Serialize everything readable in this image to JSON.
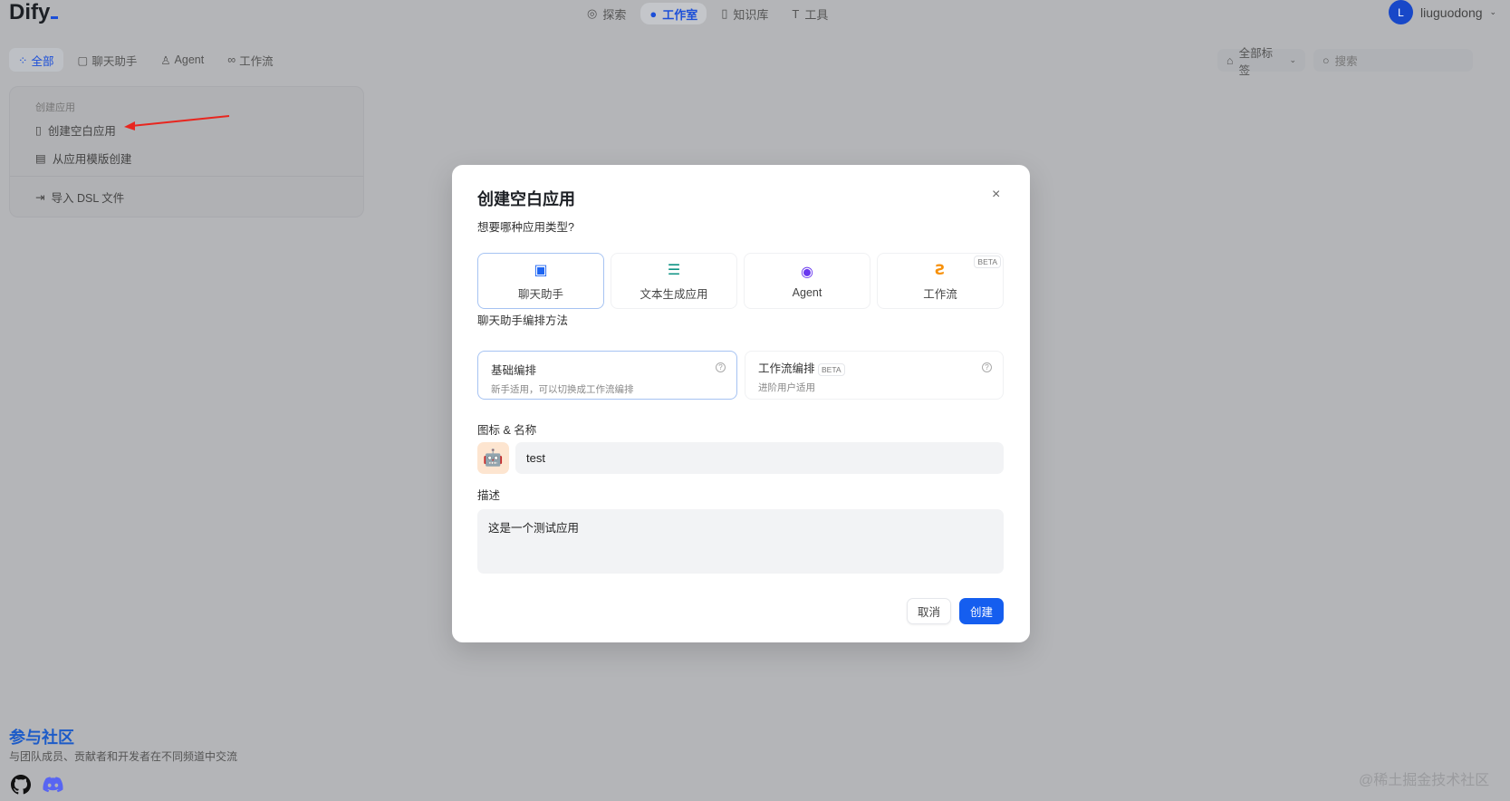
{
  "header": {
    "logo": "Dify",
    "nav": [
      {
        "label": "探索",
        "icon": "compass-icon"
      },
      {
        "label": "工作室",
        "icon": "robot-icon",
        "active": true
      },
      {
        "label": "知识库",
        "icon": "book-icon"
      },
      {
        "label": "工具",
        "icon": "hammer-icon"
      }
    ],
    "user": {
      "initial": "L",
      "name": "liuguodong"
    }
  },
  "tabs": [
    {
      "label": "全部",
      "active": true
    },
    {
      "label": "聊天助手"
    },
    {
      "label": "Agent"
    },
    {
      "label": "工作流"
    }
  ],
  "filters": {
    "tags": "全部标签",
    "search_placeholder": "搜索"
  },
  "create_card": {
    "section": "创建应用",
    "items": [
      "创建空白应用",
      "从应用模版创建",
      "导入 DSL 文件"
    ]
  },
  "community": {
    "title": "参与社区",
    "subtitle": "与团队成员、贡献者和开发者在不同频道中交流"
  },
  "watermark": "@稀土掘金技术社区",
  "modal": {
    "title": "创建空白应用",
    "close": "×",
    "type_label": "想要哪种应用类型?",
    "types": [
      {
        "label": "聊天助手",
        "selected": true
      },
      {
        "label": "文本生成应用"
      },
      {
        "label": "Agent"
      },
      {
        "label": "工作流",
        "badge": "BETA"
      }
    ],
    "mode_label": "聊天助手编排方法",
    "modes": [
      {
        "title": "基础编排",
        "desc": "新手适用，可以切换成工作流编排",
        "selected": true
      },
      {
        "title": "工作流编排",
        "badge": "BETA",
        "desc": "进阶用户适用"
      }
    ],
    "name_label": "图标 & 名称",
    "name_value": "test",
    "desc_label": "描述",
    "desc_value": "这是一个测试应用",
    "cancel": "取消",
    "create": "创建"
  },
  "colors": {
    "accent": "#155eef",
    "arrow": "#e8261f"
  }
}
